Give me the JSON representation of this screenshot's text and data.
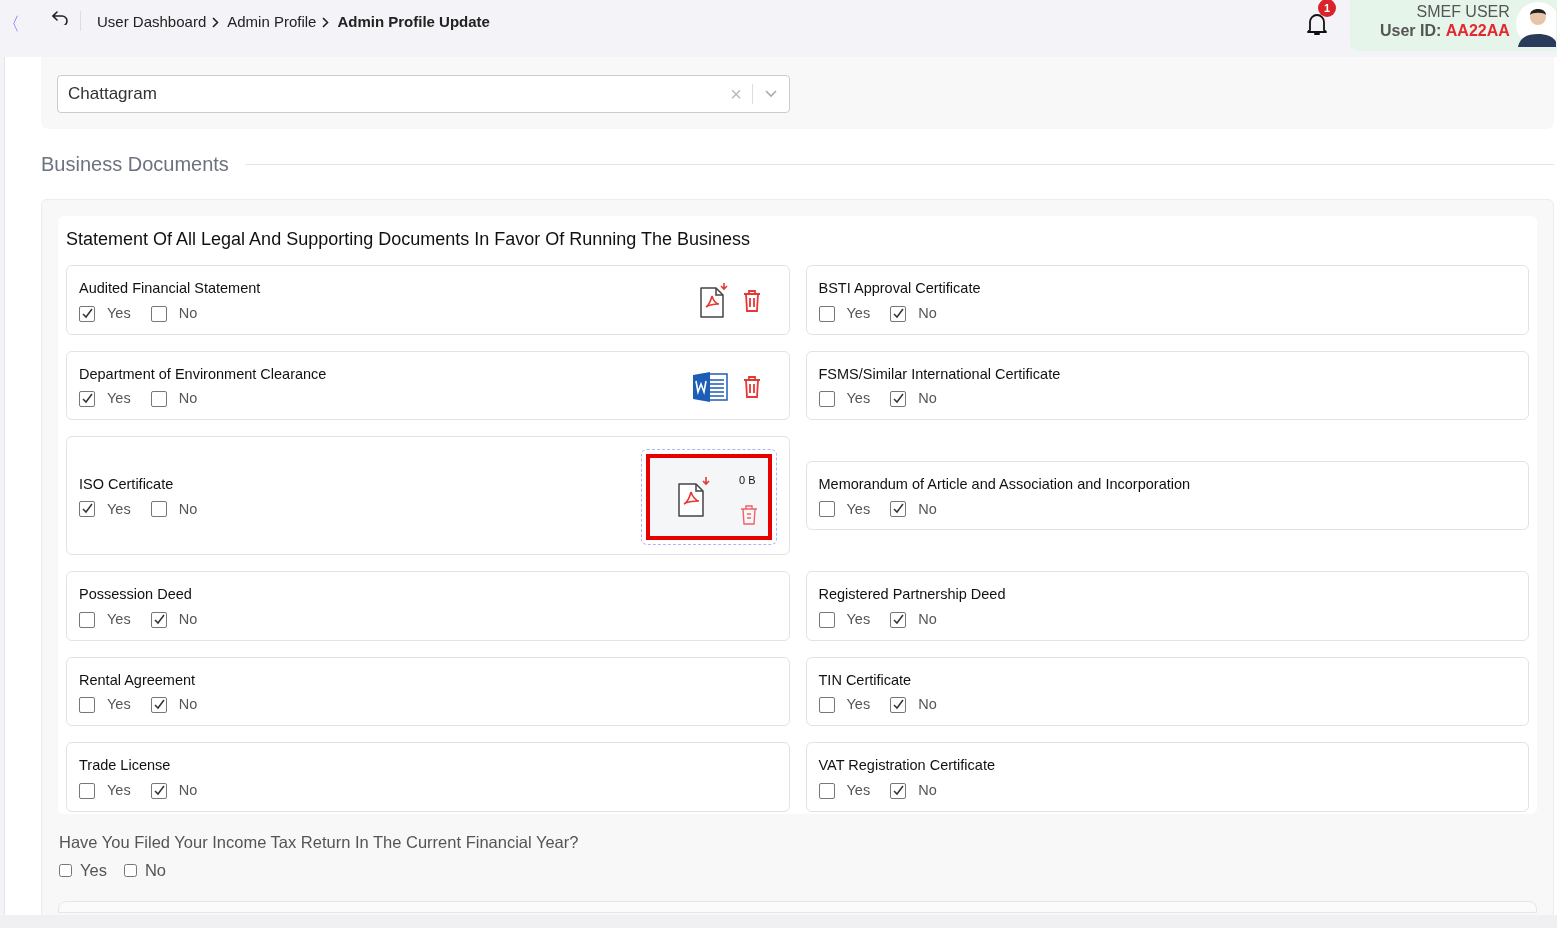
{
  "header": {
    "back_label": "〈",
    "breadcrumbs": [
      {
        "label": "User Dashboard",
        "current": false
      },
      {
        "label": "Admin Profile",
        "current": false
      },
      {
        "label": "Admin Profile Update",
        "current": true
      }
    ],
    "notification_count": "1",
    "user_name": "SMEF USER",
    "user_id_label": "User ID:",
    "user_id": "AA22AA"
  },
  "division": {
    "value": "Chattagram",
    "clear": "×"
  },
  "section_title": "Business Documents",
  "documents_card": {
    "title": "Statement Of All Legal And Supporting Documents In Favor Of Running The Business",
    "rows": [
      [
        {
          "label": "Audited Financial Statement",
          "yes_label": "Yes",
          "no_label": "No",
          "yes": true,
          "no": false,
          "file": {
            "kind": "pdf"
          }
        },
        {
          "label": "BSTI Approval Certificate",
          "yes_label": "Yes",
          "no_label": "No",
          "yes": false,
          "no": true
        }
      ],
      [
        {
          "label": "Department of Environment Clearance",
          "yes_label": "Yes",
          "no_label": "No",
          "yes": true,
          "no": false,
          "file": {
            "kind": "word"
          }
        },
        {
          "label": "FSMS/Similar International Certificate",
          "yes_label": "Yes",
          "no_label": "No",
          "yes": false,
          "no": true
        }
      ],
      [
        {
          "label": "ISO Certificate",
          "yes_label": "Yes",
          "no_label": "No",
          "yes": true,
          "no": false,
          "file": {
            "kind": "pdf-preview",
            "size": "0 B",
            "highlighted": true
          }
        },
        {
          "label": "Memorandum of Article and Association and Incorporation",
          "yes_label": "Yes",
          "no_label": "No",
          "yes": false,
          "no": true
        }
      ],
      [
        {
          "label": "Possession Deed",
          "yes_label": "Yes",
          "no_label": "No",
          "yes": false,
          "no": true
        },
        {
          "label": "Registered Partnership Deed",
          "yes_label": "Yes",
          "no_label": "No",
          "yes": false,
          "no": true
        }
      ],
      [
        {
          "label": "Rental Agreement",
          "yes_label": "Yes",
          "no_label": "No",
          "yes": false,
          "no": true
        },
        {
          "label": "TIN Certificate",
          "yes_label": "Yes",
          "no_label": "No",
          "yes": false,
          "no": true
        }
      ],
      [
        {
          "label": "Trade License",
          "yes_label": "Yes",
          "no_label": "No",
          "yes": false,
          "no": true
        },
        {
          "label": "VAT Registration Certificate",
          "yes_label": "Yes",
          "no_label": "No",
          "yes": false,
          "no": true
        }
      ]
    ]
  },
  "tax_question": {
    "text": "Have You Filed Your Income Tax Return In The Current Financial Year?",
    "yes_label": "Yes",
    "no_label": "No",
    "yes": false,
    "no": false
  }
}
